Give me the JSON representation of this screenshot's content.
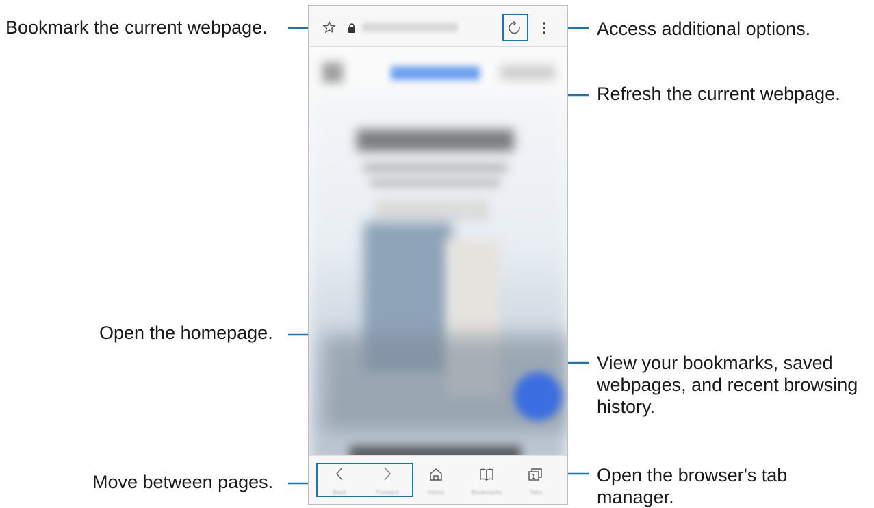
{
  "callouts": {
    "bookmark": "Bookmark the current webpage.",
    "options": "Access additional options.",
    "refresh": "Refresh the current webpage.",
    "homepage": "Open the homepage.",
    "bookmarks_view": "View your bookmarks, saved webpages, and recent browsing history.",
    "move_pages": "Move between pages.",
    "tab_manager": "Open the browser's tab manager."
  },
  "browser": {
    "nav": {
      "back_label": "Back",
      "forward_label": "Forward",
      "home_label": "Home",
      "bookmarks_label": "Bookmarks",
      "tabs_label": "Tabs",
      "tabs_count": "1"
    }
  },
  "colors": {
    "callout_line": "#1677b8",
    "highlight": "#1677b8"
  },
  "icons": {
    "bookmark": "star-icon",
    "secure": "lock-icon",
    "refresh": "refresh-icon",
    "more": "more-options-icon",
    "back": "chevron-left-icon",
    "forward": "chevron-right-icon",
    "home": "home-icon",
    "bookmarks": "book-icon",
    "tabs": "tabs-icon"
  }
}
